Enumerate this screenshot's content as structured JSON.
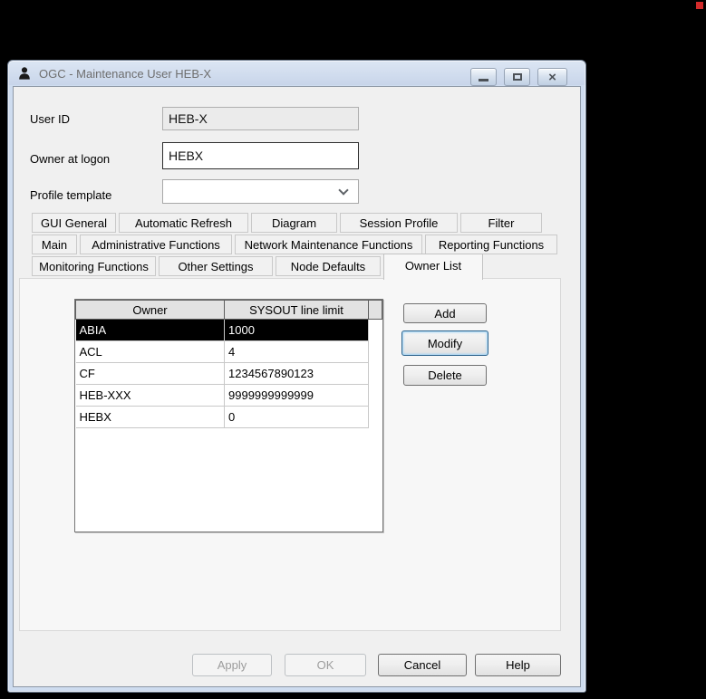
{
  "stage": {
    "background": "#000000",
    "marker_color": "#D22B2B"
  },
  "window": {
    "title": "OGC - Maintenance User HEB-X",
    "icons": {
      "app": "user-silhouette-icon",
      "caption": [
        "minimize-icon",
        "maximize-icon",
        "close-icon"
      ],
      "combo": "chevron-down-icon"
    },
    "close_glyph": "×",
    "colors": {
      "titlebar": "#CEDCEF",
      "client_bg": "#F0F0F0",
      "selection_bg": "#000000",
      "focus_blue": "#2C628B"
    }
  },
  "fields": {
    "user_id": {
      "label": "User ID",
      "value": "HEB-X",
      "disabled": true
    },
    "owner_at_logon": {
      "label": "Owner at logon",
      "value": "HEBX"
    },
    "profile_template": {
      "label": "Profile template",
      "value": "",
      "placeholder": ""
    }
  },
  "tabs": {
    "selected": "Owner List",
    "rows": [
      [
        "GUI General",
        "Automatic Refresh",
        "Diagram",
        "Session Profile",
        "Filter"
      ],
      [
        "Main",
        "Administrative Functions",
        "Network Maintenance Functions",
        "Reporting Functions"
      ],
      [
        "Monitoring Functions",
        "Other Settings",
        "Node Defaults",
        "Owner List"
      ]
    ]
  },
  "owner_table": {
    "headers": {
      "owner": "Owner",
      "limit": "SYSOUT line limit"
    },
    "rows": [
      {
        "owner": "ABIA",
        "limit": "1000",
        "selected": true
      },
      {
        "owner": "ACL",
        "limit": "4",
        "selected": false
      },
      {
        "owner": "CF",
        "limit": "1234567890123",
        "selected": false
      },
      {
        "owner": "HEB-XXX",
        "limit": "9999999999999",
        "selected": false
      },
      {
        "owner": "HEBX",
        "limit": "0",
        "selected": false
      }
    ]
  },
  "side_buttons": {
    "add": "Add",
    "modify": "Modify",
    "delete": "Delete"
  },
  "footer_buttons": {
    "apply": "Apply",
    "ok": "OK",
    "cancel": "Cancel",
    "help": "Help"
  }
}
